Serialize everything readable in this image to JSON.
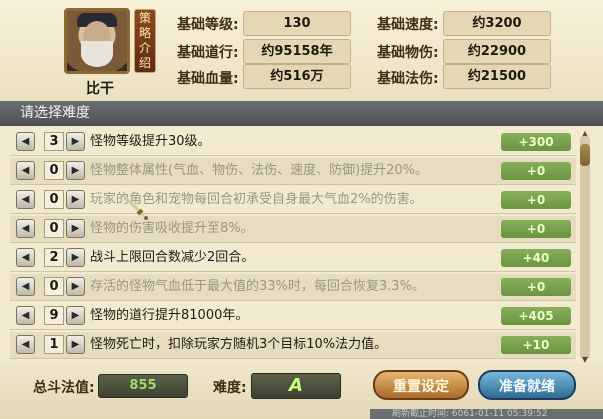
{
  "hero": {
    "name": "比干",
    "strategy_label": [
      "策",
      "略",
      "介",
      "绍"
    ]
  },
  "stats": [
    {
      "label": "基础等级:",
      "value": "130"
    },
    {
      "label": "基础道行:",
      "value": "约95158年"
    },
    {
      "label": "基础血量:",
      "value": "约516万"
    },
    {
      "label": "基础速度:",
      "value": "约3200"
    },
    {
      "label": "基础物伤:",
      "value": "约22900"
    },
    {
      "label": "基础法伤:",
      "value": "约21500"
    }
  ],
  "header_title": "请选择难度",
  "difficulty_rows": [
    {
      "level": "3",
      "text": "怪物等级提升30级。",
      "dim": false,
      "bonus": "+300"
    },
    {
      "level": "0",
      "text": "怪物整体属性(气血、物伤、法伤、速度、防御)提升20%。",
      "dim": true,
      "bonus": "+0"
    },
    {
      "level": "0",
      "text": "玩家的角色和宠物每回合初承受自身最大气血2%的伤害。",
      "dim": true,
      "bonus": "+0"
    },
    {
      "level": "0",
      "text": "怪物的伤害吸收提升至8%。",
      "dim": true,
      "bonus": "+0"
    },
    {
      "level": "2",
      "text": "战斗上限回合数减少2回合。",
      "dim": false,
      "bonus": "+40"
    },
    {
      "level": "0",
      "text": "存活的怪物气血低于最大值的33%时，每回合恢复3.3%。",
      "dim": true,
      "bonus": "+0"
    },
    {
      "level": "9",
      "text": "怪物的道行提升81000年。",
      "dim": false,
      "bonus": "+405"
    },
    {
      "level": "1",
      "text": "怪物死亡时，扣除玩家方随机3个目标10%法力值。",
      "dim": false,
      "bonus": "+10"
    }
  ],
  "footer": {
    "total_label": "总斗法值:",
    "total_value": "855",
    "difficulty_label": "难度:",
    "difficulty_value": "A",
    "reset_label": "重置设定",
    "ready_label": "准备就绪",
    "strip_text": "刷新截止时间: 6061-01-11 05:39:52"
  },
  "icons": {
    "decrease": "left-arrow-icon",
    "increase": "right-arrow-icon",
    "cursor": "sword-cursor-icon"
  }
}
